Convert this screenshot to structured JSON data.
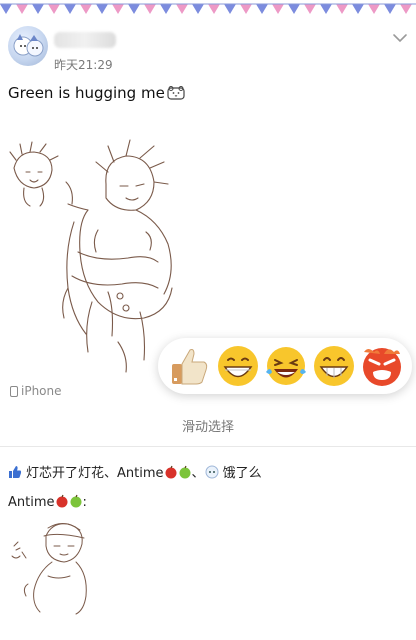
{
  "post": {
    "timestamp": "昨天21:29",
    "text": "Green is hugging me",
    "device": "iPhone"
  },
  "reactions": {
    "items": [
      "thumbs-up",
      "grin",
      "laughing-tears",
      "grin-sweat",
      "angry"
    ],
    "swipe_hint": "滑动选择"
  },
  "likes": {
    "text": "灯芯开了灯花、Antime",
    "separator": "、",
    "suffix": "饿了么"
  },
  "comment": {
    "author": "Antime",
    "colon": ":"
  },
  "colors": {
    "banner_blue": "#5b6fd6",
    "banner_pink": "#e87fb8",
    "sketch": "#7a5a4a",
    "like_blue": "#3b6fd1"
  }
}
